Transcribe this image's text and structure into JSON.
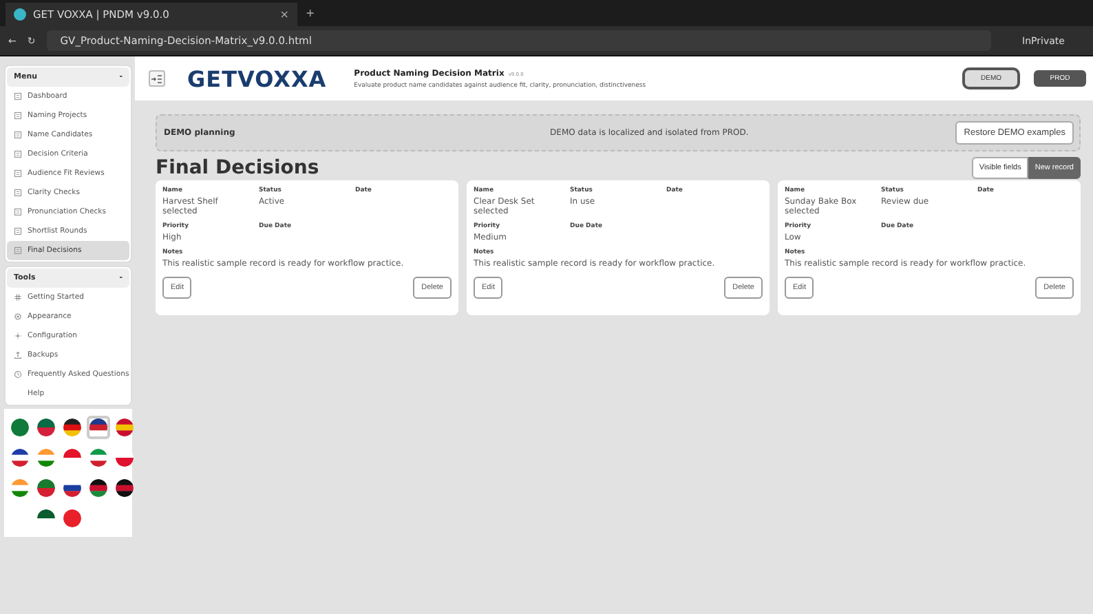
{
  "browser": {
    "tab_title": "GET VOXXA | PNDM v9.0.0",
    "new_tab": "+",
    "tab_close": "×",
    "back": "←",
    "reload": "↻",
    "address": "GV_Product-Naming-Decision-Matrix_v9.0.0.html",
    "private_label": "InPrivate"
  },
  "header": {
    "logo": "GETVOXXA",
    "title": "Product Naming Decision Matrix",
    "version": "v9.0.0",
    "subtitle": "Evaluate product name candidates against audience fit, clarity, pronunciation, distinctiveness",
    "modes": [
      {
        "label": "DEMO",
        "selected": true
      },
      {
        "label": "PROD",
        "selected": false
      }
    ]
  },
  "sidebar": {
    "sections": [
      {
        "title": "Menu",
        "toggle": "-",
        "items": [
          {
            "label": "Dashboard",
            "selected": false
          },
          {
            "label": "Naming Projects",
            "selected": false
          },
          {
            "label": "Name Candidates",
            "selected": false
          },
          {
            "label": "Decision Criteria",
            "selected": false
          },
          {
            "label": "Audience Fit Reviews",
            "selected": false
          },
          {
            "label": "Clarity Checks",
            "selected": false
          },
          {
            "label": "Pronunciation Checks",
            "selected": false
          },
          {
            "label": "Shortlist Rounds",
            "selected": false
          },
          {
            "label": "Final Decisions",
            "selected": true
          }
        ]
      },
      {
        "title": "Tools",
        "toggle": "-",
        "items": [
          {
            "label": "Getting Started",
            "selected": false
          },
          {
            "label": "Appearance",
            "selected": false
          },
          {
            "label": "Configuration",
            "selected": false
          },
          {
            "label": "Backups",
            "selected": false
          },
          {
            "label": "Frequently Asked Questions",
            "selected": false
          },
          {
            "label": "Help",
            "selected": false
          }
        ]
      }
    ],
    "flags": [
      {
        "selected": false
      },
      {
        "selected": false
      },
      {
        "selected": false
      },
      {
        "selected": true
      },
      {
        "selected": false
      },
      {
        "selected": false
      },
      {
        "selected": false
      },
      {
        "selected": false
      },
      {
        "selected": false
      },
      {
        "selected": false
      },
      {
        "selected": false
      },
      {
        "selected": false
      },
      {
        "selected": false
      },
      {
        "selected": false
      },
      {
        "selected": false
      },
      {
        "selected": false
      },
      {
        "selected": false
      }
    ]
  },
  "banner": {
    "label": "DEMO planning",
    "message": "DEMO data is localized and isolated from PROD.",
    "button": "Restore DEMO examples"
  },
  "page": {
    "title": "Final Decisions",
    "actions": [
      {
        "label": "Visible fields",
        "kind": "outline"
      },
      {
        "label": "New record",
        "kind": "filled"
      }
    ]
  },
  "records": [
    {
      "fields": [
        {
          "label": "Name",
          "value": "Harvest Shelf selected"
        },
        {
          "label": "Status",
          "value": "Active"
        },
        {
          "label": "Date"
        },
        {
          "label": "Priority",
          "value": "High"
        },
        {
          "label": "Due Date"
        }
      ],
      "notes_label": "Notes",
      "notes": "This realistic sample record is ready for workflow practice.",
      "edit": "Edit",
      "delete": "Delete"
    },
    {
      "fields": [
        {
          "label": "Name",
          "value": "Clear Desk Set selected"
        },
        {
          "label": "Status",
          "value": "In use"
        },
        {
          "label": "Date"
        },
        {
          "label": "Priority",
          "value": "Medium"
        },
        {
          "label": "Due Date"
        }
      ],
      "notes_label": "Notes",
      "notes": "This realistic sample record is ready for workflow practice.",
      "edit": "Edit",
      "delete": "Delete"
    },
    {
      "fields": [
        {
          "label": "Name",
          "value": "Sunday Bake Box selected"
        },
        {
          "label": "Status",
          "value": "Review due"
        },
        {
          "label": "Date"
        },
        {
          "label": "Priority",
          "value": "Low"
        },
        {
          "label": "Due Date"
        }
      ],
      "notes_label": "Notes",
      "notes": "This realistic sample record is ready for workflow practice.",
      "edit": "Edit",
      "delete": "Delete"
    }
  ]
}
